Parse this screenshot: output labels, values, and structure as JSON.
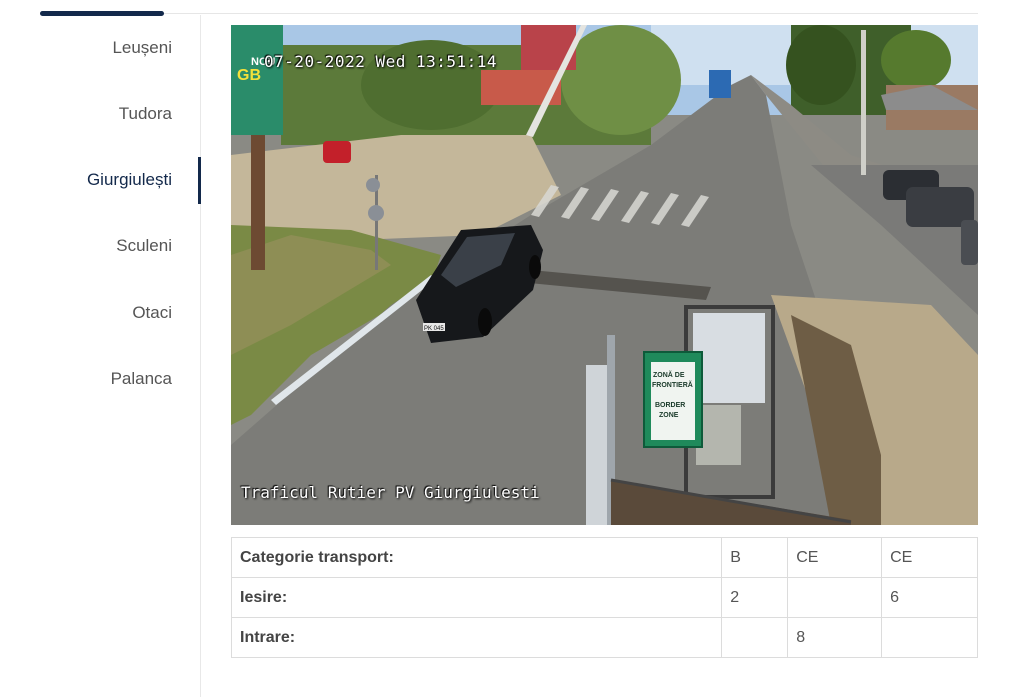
{
  "sidebar": {
    "items": [
      {
        "label": "Leușeni"
      },
      {
        "label": "Tudora"
      },
      {
        "label": "Giurgiulești",
        "active": true
      },
      {
        "label": "Sculeni"
      },
      {
        "label": "Otaci"
      },
      {
        "label": "Palanca"
      }
    ]
  },
  "camera": {
    "timestamp": "07-20-2022 Wed 13:51:14",
    "caption": "Traficul Rutier PV Giurgiulesti",
    "billboard": {
      "line1": "GB",
      "line2": "NOU"
    },
    "sign": {
      "line1": "ZONĂ DE",
      "line2": "FRONTIERĂ",
      "line3": "BORDER",
      "line4": "ZONE"
    },
    "plate": "PK 045"
  },
  "table": {
    "rows": [
      {
        "label": "Categorie transport:",
        "cells": [
          "B",
          "CE",
          "CE"
        ]
      },
      {
        "label": "Iesire:",
        "cells": [
          "2",
          "",
          "6"
        ]
      },
      {
        "label": "Intrare:",
        "cells": [
          "",
          "8",
          ""
        ]
      }
    ]
  },
  "colors": {
    "accent": "#13294b",
    "border": "#dcdcdc"
  }
}
